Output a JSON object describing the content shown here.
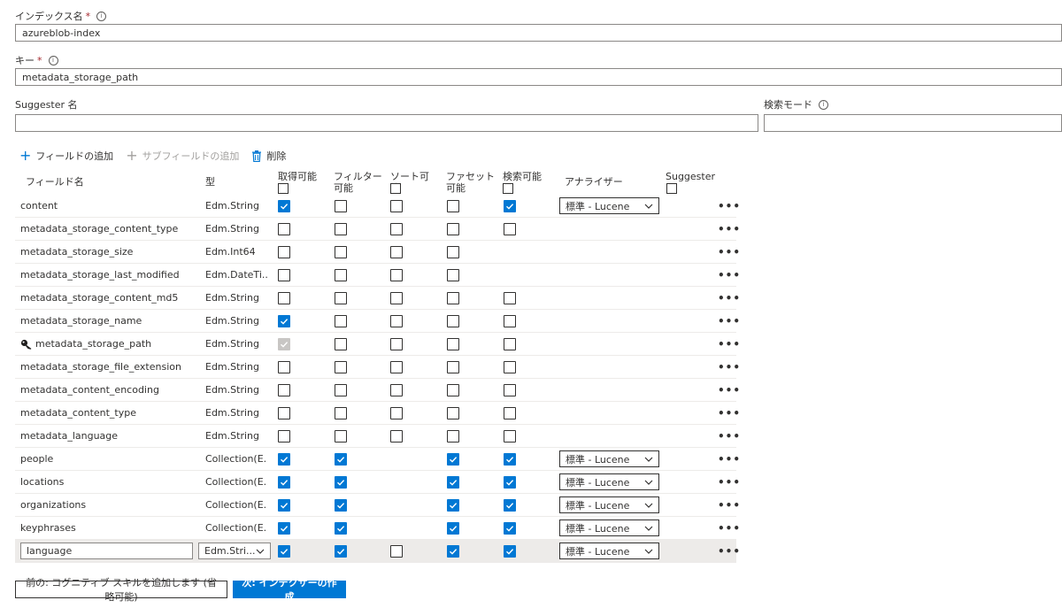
{
  "form": {
    "index_name_label": "インデックス名",
    "index_name_value": "azureblob-index",
    "key_label": "キー",
    "key_value": "metadata_storage_path",
    "suggester_label": "Suggester 名",
    "suggester_value": "",
    "search_mode_label": "検索モード",
    "search_mode_value": "",
    "required_mark": "*",
    "info_glyph": "i"
  },
  "toolbar": {
    "add_field": "フィールドの追加",
    "add_subfield": "サブフィールドの追加",
    "delete": "削除"
  },
  "columns": {
    "field_name": "フィールド名",
    "type": "型",
    "retrievable": "取得可能",
    "filterable": "フィルター可能",
    "sortable": "ソート可能",
    "facetable": "ファセット可能",
    "searchable": "検索可能",
    "analyzer": "アナライザー",
    "suggester": "Suggester"
  },
  "rows": [
    {
      "name": "content",
      "type": "Edm.String",
      "flags": [
        1,
        0,
        0,
        0,
        1
      ],
      "analyzer": "標準 - Lucene"
    },
    {
      "name": "metadata_storage_content_type",
      "type": "Edm.String",
      "flags": [
        0,
        0,
        0,
        0,
        0
      ],
      "analyzer": ""
    },
    {
      "name": "metadata_storage_size",
      "type": "Edm.Int64",
      "flags": [
        0,
        0,
        0,
        0,
        null
      ],
      "analyzer": ""
    },
    {
      "name": "metadata_storage_last_modified",
      "type": "Edm.DateTi...",
      "flags": [
        0,
        0,
        0,
        0,
        null
      ],
      "analyzer": ""
    },
    {
      "name": "metadata_storage_content_md5",
      "type": "Edm.String",
      "flags": [
        0,
        0,
        0,
        0,
        0
      ],
      "analyzer": ""
    },
    {
      "name": "metadata_storage_name",
      "type": "Edm.String",
      "flags": [
        1,
        0,
        0,
        0,
        0
      ],
      "analyzer": ""
    },
    {
      "name": "metadata_storage_path",
      "type": "Edm.String",
      "flags": [
        2,
        0,
        0,
        0,
        0
      ],
      "analyzer": "",
      "key": true
    },
    {
      "name": "metadata_storage_file_extension",
      "type": "Edm.String",
      "flags": [
        0,
        0,
        0,
        0,
        0
      ],
      "analyzer": ""
    },
    {
      "name": "metadata_content_encoding",
      "type": "Edm.String",
      "flags": [
        0,
        0,
        0,
        0,
        0
      ],
      "analyzer": ""
    },
    {
      "name": "metadata_content_type",
      "type": "Edm.String",
      "flags": [
        0,
        0,
        0,
        0,
        0
      ],
      "analyzer": ""
    },
    {
      "name": "metadata_language",
      "type": "Edm.String",
      "flags": [
        0,
        0,
        0,
        0,
        0
      ],
      "analyzer": ""
    },
    {
      "name": "people",
      "type": "Collection(E...",
      "flags": [
        1,
        1,
        null,
        1,
        1
      ],
      "analyzer": "標準 - Lucene"
    },
    {
      "name": "locations",
      "type": "Collection(E...",
      "flags": [
        1,
        1,
        null,
        1,
        1
      ],
      "analyzer": "標準 - Lucene"
    },
    {
      "name": "organizations",
      "type": "Collection(E...",
      "flags": [
        1,
        1,
        null,
        1,
        1
      ],
      "analyzer": "標準 - Lucene"
    },
    {
      "name": "keyphrases",
      "type": "Collection(E...",
      "flags": [
        1,
        1,
        null,
        1,
        1
      ],
      "analyzer": "標準 - Lucene"
    },
    {
      "name": "language",
      "type": "Edm.Stri...",
      "flags": [
        1,
        1,
        0,
        1,
        1
      ],
      "analyzer": "標準 - Lucene",
      "editing": true
    }
  ],
  "more_glyph": "•••",
  "buttons": {
    "previous": "前の: コグニティブ スキルを追加します (省略可能)",
    "next": "次: インデクサーの作成"
  }
}
